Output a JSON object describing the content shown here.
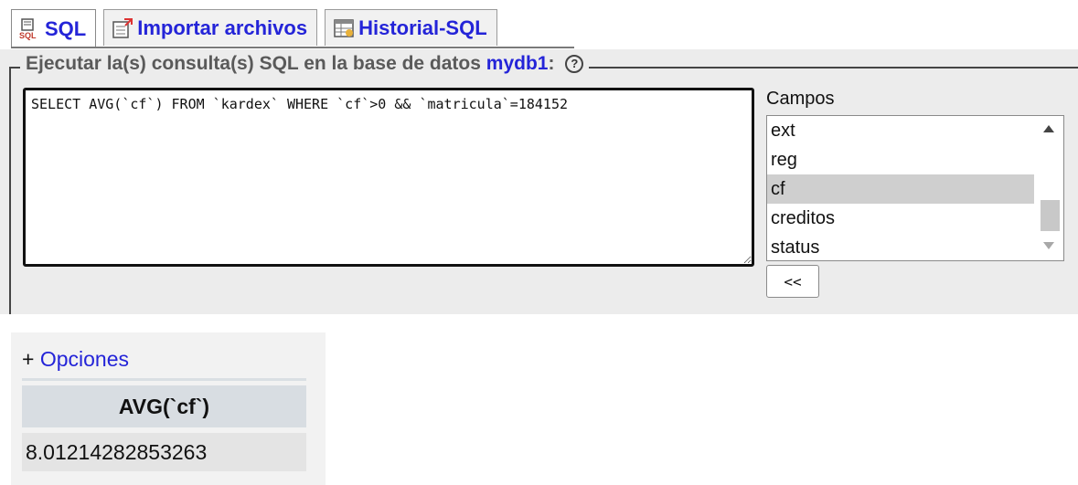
{
  "tabs": [
    {
      "label": "SQL",
      "icon": "sql-icon",
      "active": true
    },
    {
      "label": "Importar archivos",
      "icon": "import-icon",
      "active": false
    },
    {
      "label": "Historial-SQL",
      "icon": "history-icon",
      "active": false
    }
  ],
  "fieldset": {
    "legend_prefix": "Ejecutar la(s) consulta(s) SQL en la base de datos",
    "db_name": "mydb1",
    "legend_suffix": ":"
  },
  "query": {
    "value": "SELECT AVG(`cf`) FROM `kardex` WHERE `cf`>0 && `matricula`=184152"
  },
  "campos": {
    "label": "Campos",
    "items": [
      "ext",
      "reg",
      "cf",
      "creditos",
      "status"
    ],
    "selected": "cf",
    "back_button": "<<"
  },
  "results": {
    "options_plus": "+",
    "options_label": "Opciones",
    "column_header": "AVG(`cf`)",
    "value": "8.01214282853263"
  },
  "colors": {
    "link": "#2424d8",
    "panel_bg": "#ececec"
  }
}
